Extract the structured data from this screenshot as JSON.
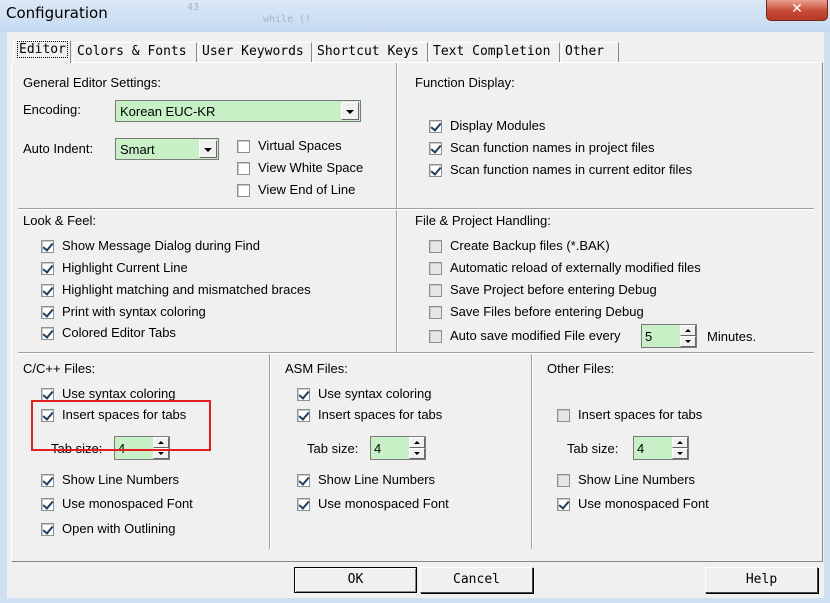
{
  "window": {
    "title": "Configuration",
    "close_glyph": "✕",
    "background_text": "43",
    "background_code": "while (!"
  },
  "tabs": [
    {
      "label": "Editor",
      "active": true
    },
    {
      "label": "Colors & Fonts",
      "active": false
    },
    {
      "label": "User Keywords",
      "active": false
    },
    {
      "label": "Shortcut Keys",
      "active": false
    },
    {
      "label": "Text Completion",
      "active": false
    },
    {
      "label": "Other",
      "active": false
    }
  ],
  "general": {
    "title": "General Editor Settings:",
    "encoding_label": "Encoding:",
    "encoding_value": "Korean EUC-KR",
    "auto_indent_label": "Auto Indent:",
    "auto_indent_value": "Smart",
    "virtual_spaces": {
      "label": "Virtual Spaces",
      "checked": false
    },
    "view_white_space": {
      "label": "View White Space",
      "checked": false
    },
    "view_end_of_line": {
      "label": "View End of Line",
      "checked": false
    }
  },
  "function_display": {
    "title": "Function Display:",
    "items": [
      {
        "label": "Display Modules",
        "checked": true
      },
      {
        "label": "Scan function names in project files",
        "checked": true
      },
      {
        "label": "Scan function names in current editor files",
        "checked": true
      }
    ]
  },
  "look_feel": {
    "title": "Look & Feel:",
    "items": [
      {
        "label": "Show Message Dialog during Find",
        "checked": true
      },
      {
        "label": "Highlight Current Line",
        "checked": true
      },
      {
        "label": "Highlight matching and mismatched braces",
        "checked": true
      },
      {
        "label": "Print with syntax coloring",
        "checked": true
      },
      {
        "label": "Colored Editor Tabs",
        "checked": true
      }
    ]
  },
  "file_project": {
    "title": "File & Project Handling:",
    "items": [
      {
        "label": "Create Backup files (*.BAK)",
        "checked": false
      },
      {
        "label": "Automatic reload of externally modified files",
        "checked": false
      },
      {
        "label": "Save Project before entering Debug",
        "checked": false
      },
      {
        "label": "Save Files before entering Debug",
        "checked": false
      }
    ],
    "autosave_label": "Auto save modified File every",
    "autosave_value": "5",
    "autosave_unit": "Minutes."
  },
  "cpp_files": {
    "title": "C/C++ Files:",
    "syntax_coloring": {
      "label": "Use syntax coloring",
      "checked": true
    },
    "insert_spaces": {
      "label": "Insert spaces for tabs",
      "checked": true
    },
    "tab_size_label": "Tab size:",
    "tab_size_value": "4",
    "line_numbers": {
      "label": "Show Line Numbers",
      "checked": true
    },
    "monospaced": {
      "label": "Use monospaced Font",
      "checked": true
    },
    "outlining": {
      "label": "Open with Outlining",
      "checked": true
    }
  },
  "asm_files": {
    "title": "ASM Files:",
    "syntax_coloring": {
      "label": "Use syntax coloring",
      "checked": true
    },
    "insert_spaces": {
      "label": "Insert spaces for tabs",
      "checked": true
    },
    "tab_size_label": "Tab size:",
    "tab_size_value": "4",
    "line_numbers": {
      "label": "Show Line Numbers",
      "checked": true
    },
    "monospaced": {
      "label": "Use monospaced Font",
      "checked": true
    }
  },
  "other_files": {
    "title": "Other Files:",
    "insert_spaces": {
      "label": "Insert spaces for tabs",
      "checked": false
    },
    "tab_size_label": "Tab size:",
    "tab_size_value": "4",
    "line_numbers": {
      "label": "Show Line Numbers",
      "checked": false
    },
    "monospaced": {
      "label": "Use monospaced Font",
      "checked": true
    }
  },
  "buttons": {
    "ok": "OK",
    "cancel": "Cancel",
    "help": "Help"
  },
  "colors": {
    "field_bg": "#c7f0c7",
    "highlight_border": "#e02020",
    "dialog_bg": "#f0f0f0"
  }
}
